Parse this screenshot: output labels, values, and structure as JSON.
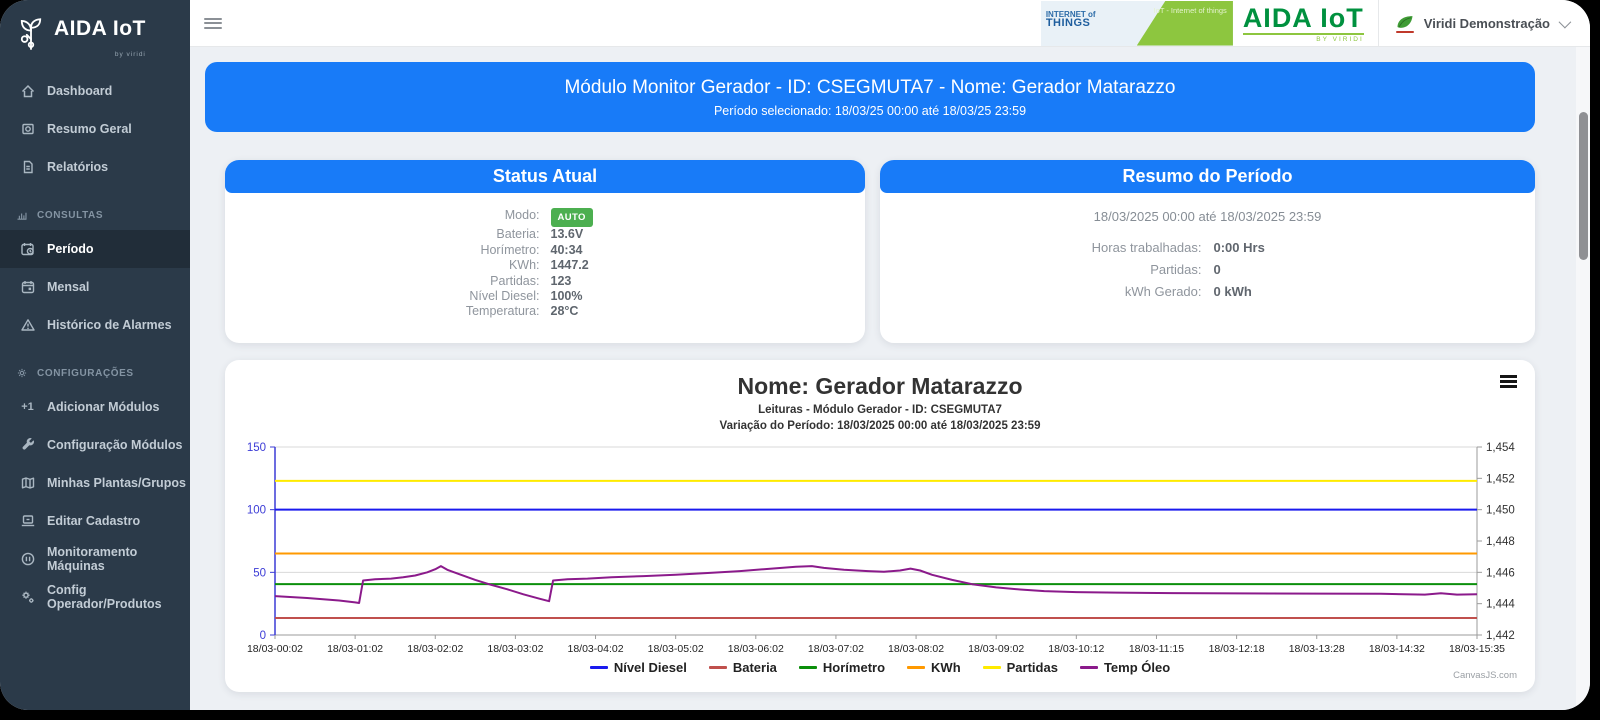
{
  "colors": {
    "accent_blue": "#187bf8",
    "badge_green": "#4caf50",
    "sidebar_bg": "#2b3a49",
    "logo_green": "#00913f"
  },
  "sidebar": {
    "logo": {
      "title": "AIDA IoT",
      "subtitle": "by viridi"
    },
    "items": [
      {
        "label": "Dashboard",
        "icon": "home-icon"
      },
      {
        "label": "Resumo Geral",
        "icon": "summary-icon"
      },
      {
        "label": "Relatórios",
        "icon": "report-icon"
      },
      {
        "label": "CONSULTAS",
        "icon": "bar-chart-icon",
        "type": "section"
      },
      {
        "label": "Período",
        "icon": "calendar-clock-icon",
        "active": true
      },
      {
        "label": "Mensal",
        "icon": "calendar-icon"
      },
      {
        "label": "Histórico de Alarmes",
        "icon": "alert-triangle-icon"
      },
      {
        "label": "CONFIGURAÇÕES",
        "icon": "gear-icon",
        "type": "section"
      },
      {
        "label": "Adicionar Módulos",
        "icon": "plus-one-icon"
      },
      {
        "label": "Configuração Módulos",
        "icon": "wrench-icon"
      },
      {
        "label": "Minhas Plantas/Grupos",
        "icon": "map-icon"
      },
      {
        "label": "Editar Cadastro",
        "icon": "laptop-icon"
      },
      {
        "label": "Monitoramento Máquinas",
        "icon": "pause-circle-icon"
      },
      {
        "label": "Config Operador/Produtos",
        "icon": "gears-icon"
      }
    ]
  },
  "header": {
    "banner": {
      "left_text_small": "INTERNET of",
      "left_text_big": "THINGS",
      "right_text": "IoT - Internet of things"
    },
    "aida_logo": {
      "text": "AIDA IoT",
      "sub": "BY VIRIDI"
    },
    "user": {
      "name": "Viridi Demonstração"
    }
  },
  "banner": {
    "title": "Módulo Monitor Gerador - ID: CSEGMUTA7 - Nome: Gerador Matarazzo",
    "subtitle": "Período selecionado: 18/03/25 00:00 até 18/03/25 23:59"
  },
  "status_card": {
    "title": "Status Atual",
    "rows": [
      {
        "label": "Modo:",
        "value": "AUTO"
      },
      {
        "label": "Bateria:",
        "value": "13.6V"
      },
      {
        "label": "Horímetro:",
        "value": "40:34"
      },
      {
        "label": "KWh:",
        "value": "1447.2"
      },
      {
        "label": "Partidas:",
        "value": "123"
      },
      {
        "label": "Nível Diesel:",
        "value": "100%"
      },
      {
        "label": "Temperatura:",
        "value": "28°C"
      }
    ]
  },
  "summary_card": {
    "title": "Resumo do Período",
    "period": "18/03/2025 00:00 até 18/03/2025 23:59",
    "rows": [
      {
        "label": "Horas trabalhadas:",
        "value": "0:00 Hrs"
      },
      {
        "label": "Partidas:",
        "value": "0"
      },
      {
        "label": "kWh Gerado:",
        "value": "0 kWh"
      }
    ]
  },
  "chart_data": {
    "type": "line",
    "title": "Nome: Gerador Matarazzo",
    "subtitle1": "Leituras - Módulo Gerador - ID: CSEGMUTA7",
    "subtitle2": "Variação do Período: 18/03/2025 00:00 até 18/03/2025 23:59",
    "credit": "CanvasJS.com",
    "legend_position": "bottom",
    "grid": true,
    "x_ticks": [
      "18/03-00:02",
      "18/03-01:02",
      "18/03-02:02",
      "18/03-03:02",
      "18/03-04:02",
      "18/03-05:02",
      "18/03-06:02",
      "18/03-07:02",
      "18/03-08:02",
      "18/03-09:02",
      "18/03-10:12",
      "18/03-11:15",
      "18/03-12:18",
      "18/03-13:28",
      "18/03-14:32",
      "18/03-15:35"
    ],
    "y_left": {
      "min": 0,
      "max": 150,
      "ticks": [
        0,
        50,
        100,
        150
      ],
      "color": "#3c3cd6"
    },
    "y_right": {
      "min": 1442,
      "max": 1454,
      "ticks": [
        1442,
        1444,
        1446,
        1448,
        1450,
        1452,
        1454
      ],
      "labels": [
        "1,442",
        "1,444",
        "1,446",
        "1,448",
        "1,450",
        "1,452",
        "1,454"
      ]
    },
    "series": [
      {
        "name": "Nível Diesel",
        "color": "#1a1aee",
        "type": "constant",
        "value": 100,
        "axis": "left"
      },
      {
        "name": "Bateria",
        "color": "#c0504d",
        "type": "constant",
        "value": 13.6,
        "axis": "left"
      },
      {
        "name": "Horímetro",
        "color": "#0b8f0b",
        "type": "constant",
        "value": 40.57,
        "axis": "left"
      },
      {
        "name": "KWh",
        "color": "#ff9900",
        "type": "constant",
        "value": 1447.2,
        "axis": "right"
      },
      {
        "name": "Partidas",
        "color": "#ffeb00",
        "type": "constant",
        "value": 123,
        "axis": "left"
      },
      {
        "name": "Temp Óleo",
        "color": "#8b1a8b",
        "type": "points",
        "axis": "left",
        "points": [
          [
            0,
            31
          ],
          [
            0.4,
            29.5
          ],
          [
            0.8,
            27.5
          ],
          [
            1.0,
            26
          ],
          [
            1.05,
            25.5
          ],
          [
            1.1,
            43.5
          ],
          [
            1.25,
            44.5
          ],
          [
            1.45,
            45
          ],
          [
            1.6,
            46
          ],
          [
            1.75,
            47.5
          ],
          [
            1.9,
            50
          ],
          [
            2.0,
            52.5
          ],
          [
            2.07,
            55
          ],
          [
            2.15,
            52
          ],
          [
            2.3,
            48.5
          ],
          [
            2.5,
            44
          ],
          [
            2.7,
            40
          ],
          [
            2.9,
            36.5
          ],
          [
            3.1,
            32.5
          ],
          [
            3.3,
            29
          ],
          [
            3.42,
            27
          ],
          [
            3.47,
            43.5
          ],
          [
            3.65,
            44.5
          ],
          [
            3.9,
            45
          ],
          [
            4.2,
            46
          ],
          [
            4.6,
            47
          ],
          [
            5.0,
            48
          ],
          [
            5.4,
            49.5
          ],
          [
            5.8,
            51
          ],
          [
            6.2,
            53
          ],
          [
            6.5,
            54.5
          ],
          [
            6.7,
            55
          ],
          [
            6.85,
            53.5
          ],
          [
            7.1,
            52
          ],
          [
            7.4,
            51
          ],
          [
            7.6,
            50.5
          ],
          [
            7.8,
            51.5
          ],
          [
            7.93,
            53
          ],
          [
            8.05,
            51.5
          ],
          [
            8.2,
            48
          ],
          [
            8.45,
            44
          ],
          [
            8.7,
            40.5
          ],
          [
            9.0,
            38
          ],
          [
            9.3,
            36.3
          ],
          [
            9.6,
            35
          ],
          [
            10.0,
            34.2
          ],
          [
            10.5,
            33.8
          ],
          [
            11.2,
            33.4
          ],
          [
            12.0,
            33.2
          ],
          [
            13.0,
            33
          ],
          [
            13.8,
            32.9
          ],
          [
            14.35,
            32.2
          ],
          [
            14.55,
            33.3
          ],
          [
            14.75,
            32.2
          ],
          [
            15,
            32.5
          ]
        ]
      }
    ]
  }
}
